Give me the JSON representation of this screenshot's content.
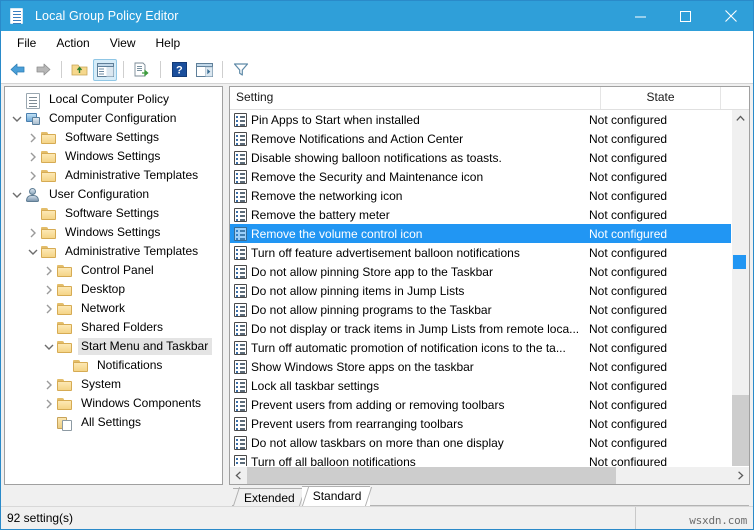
{
  "window": {
    "title": "Local Group Policy Editor",
    "icon": "policy-document-icon",
    "accent_color": "#2f9fd9",
    "selection_color": "#2196f3",
    "buttons": {
      "minimize": "minimize-icon",
      "maximize": "maximize-icon",
      "close": "close-icon"
    }
  },
  "menubar": {
    "items": [
      {
        "label": "File"
      },
      {
        "label": "Action"
      },
      {
        "label": "View"
      },
      {
        "label": "Help"
      }
    ]
  },
  "toolbar": {
    "buttons": [
      {
        "name": "back-button",
        "icon": "left-arrow-icon",
        "pressed": false
      },
      {
        "name": "forward-button",
        "icon": "right-arrow-icon",
        "pressed": false
      },
      {
        "name": "up-one-level-button",
        "icon": "folder-up-icon",
        "pressed": false
      },
      {
        "name": "show-hide-console-tree-button",
        "icon": "console-tree-icon",
        "pressed": true
      },
      {
        "name": "export-list-button",
        "icon": "export-list-icon",
        "pressed": false
      },
      {
        "name": "help-button",
        "icon": "help-question-icon",
        "pressed": false
      },
      {
        "name": "show-hide-action-pane-button",
        "icon": "action-pane-icon",
        "pressed": false
      },
      {
        "name": "filter-button",
        "icon": "filter-funnel-icon",
        "pressed": false
      }
    ]
  },
  "tree": {
    "nodes": [
      {
        "label": "Local Computer Policy",
        "indent": 0,
        "chevron": "none",
        "icon": "policy-document-icon",
        "selected": false
      },
      {
        "label": "Computer Configuration",
        "indent": 0,
        "chevron": "expanded",
        "icon": "computer-icon",
        "selected": false
      },
      {
        "label": "Software Settings",
        "indent": 1,
        "chevron": "collapsed",
        "icon": "folder-icon",
        "selected": false
      },
      {
        "label": "Windows Settings",
        "indent": 1,
        "chevron": "collapsed",
        "icon": "folder-icon",
        "selected": false
      },
      {
        "label": "Administrative Templates",
        "indent": 1,
        "chevron": "collapsed",
        "icon": "folder-icon",
        "selected": false
      },
      {
        "label": "User Configuration",
        "indent": 0,
        "chevron": "expanded",
        "icon": "user-icon",
        "selected": false
      },
      {
        "label": "Software Settings",
        "indent": 1,
        "chevron": "none",
        "icon": "folder-icon",
        "selected": false
      },
      {
        "label": "Windows Settings",
        "indent": 1,
        "chevron": "collapsed",
        "icon": "folder-icon",
        "selected": false
      },
      {
        "label": "Administrative Templates",
        "indent": 1,
        "chevron": "expanded",
        "icon": "folder-icon",
        "selected": false
      },
      {
        "label": "Control Panel",
        "indent": 2,
        "chevron": "collapsed",
        "icon": "folder-icon",
        "selected": false
      },
      {
        "label": "Desktop",
        "indent": 2,
        "chevron": "collapsed",
        "icon": "folder-icon",
        "selected": false
      },
      {
        "label": "Network",
        "indent": 2,
        "chevron": "collapsed",
        "icon": "folder-icon",
        "selected": false
      },
      {
        "label": "Shared Folders",
        "indent": 2,
        "chevron": "none",
        "icon": "folder-icon",
        "selected": false
      },
      {
        "label": "Start Menu and Taskbar",
        "indent": 2,
        "chevron": "expanded",
        "icon": "folder-icon",
        "selected": true
      },
      {
        "label": "Notifications",
        "indent": 3,
        "chevron": "none",
        "icon": "folder-icon",
        "selected": false
      },
      {
        "label": "System",
        "indent": 2,
        "chevron": "collapsed",
        "icon": "folder-icon",
        "selected": false
      },
      {
        "label": "Windows Components",
        "indent": 2,
        "chevron": "collapsed",
        "icon": "folder-icon",
        "selected": false
      },
      {
        "label": "All Settings",
        "indent": 2,
        "chevron": "none",
        "icon": "all-settings-icon",
        "selected": false
      }
    ]
  },
  "list": {
    "columns": [
      {
        "label": "Setting",
        "key": "setting"
      },
      {
        "label": "State",
        "key": "state"
      }
    ],
    "rows": [
      {
        "setting": "Pin Apps to Start when installed",
        "state": "Not configured",
        "selected": false
      },
      {
        "setting": "Remove Notifications and Action Center",
        "state": "Not configured",
        "selected": false
      },
      {
        "setting": "Disable showing balloon notifications as toasts.",
        "state": "Not configured",
        "selected": false
      },
      {
        "setting": "Remove the Security and Maintenance icon",
        "state": "Not configured",
        "selected": false
      },
      {
        "setting": "Remove the networking icon",
        "state": "Not configured",
        "selected": false
      },
      {
        "setting": "Remove the battery meter",
        "state": "Not configured",
        "selected": false
      },
      {
        "setting": "Remove the volume control icon",
        "state": "Not configured",
        "selected": true
      },
      {
        "setting": "Turn off feature advertisement balloon notifications",
        "state": "Not configured",
        "selected": false
      },
      {
        "setting": "Do not allow pinning Store app to the Taskbar",
        "state": "Not configured",
        "selected": false
      },
      {
        "setting": "Do not allow pinning items in Jump Lists",
        "state": "Not configured",
        "selected": false
      },
      {
        "setting": "Do not allow pinning programs to the Taskbar",
        "state": "Not configured",
        "selected": false
      },
      {
        "setting": "Do not display or track items in Jump Lists from remote loca...",
        "state": "Not configured",
        "selected": false
      },
      {
        "setting": "Turn off automatic promotion of notification icons to the ta...",
        "state": "Not configured",
        "selected": false
      },
      {
        "setting": "Show Windows Store apps on the taskbar",
        "state": "Not configured",
        "selected": false
      },
      {
        "setting": "Lock all taskbar settings",
        "state": "Not configured",
        "selected": false
      },
      {
        "setting": "Prevent users from adding or removing toolbars",
        "state": "Not configured",
        "selected": false
      },
      {
        "setting": "Prevent users from rearranging toolbars",
        "state": "Not configured",
        "selected": false
      },
      {
        "setting": "Do not allow taskbars on more than one display",
        "state": "Not configured",
        "selected": false
      },
      {
        "setting": "Turn off all balloon notifications",
        "state": "Not configured",
        "selected": false
      }
    ]
  },
  "tabs": [
    {
      "label": "Extended",
      "active": false
    },
    {
      "label": "Standard",
      "active": true
    }
  ],
  "statusbar": {
    "text": "92 setting(s)",
    "watermark": "wsxdn.com"
  }
}
